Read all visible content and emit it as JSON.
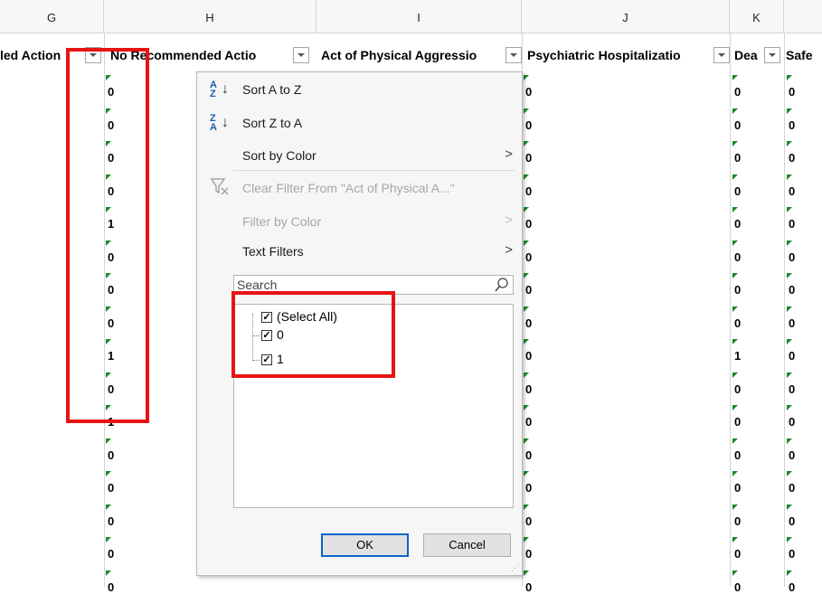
{
  "column_letters": [
    "G",
    "H",
    "I",
    "J",
    "K"
  ],
  "headers": {
    "g": "led Action",
    "h": "No Recommended Actio",
    "i": "Act of Physical Aggressio",
    "j": "Psychiatric Hospitalizatio",
    "k": "Dea",
    "l": "Safe"
  },
  "col_g_values": [
    "0",
    "0",
    "0",
    "0",
    "1",
    "0",
    "0",
    "0",
    "1",
    "0",
    "1",
    "0",
    "0",
    "0",
    "0",
    "0"
  ],
  "col_j_values": [
    "0",
    "0",
    "0",
    "0",
    "0",
    "0",
    "0",
    "0",
    "0",
    "0",
    "0",
    "0",
    "0",
    "0",
    "0",
    "0"
  ],
  "col_k_values": [
    "0",
    "0",
    "0",
    "0",
    "0",
    "0",
    "0",
    "0",
    "1",
    "0",
    "0",
    "0",
    "0",
    "0",
    "0",
    "0"
  ],
  "col_l_values": [
    "0",
    "0",
    "0",
    "0",
    "0",
    "0",
    "0",
    "0",
    "0",
    "0",
    "0",
    "0",
    "0",
    "0",
    "0",
    "0"
  ],
  "menu": {
    "sort_az": "Sort A to Z",
    "sort_za": "Sort Z to A",
    "sort_by_color": "Sort by Color",
    "clear_filter": "Clear Filter From \"Act of Physical A...\"",
    "filter_by_color": "Filter by Color",
    "text_filters": "Text Filters",
    "search_placeholder": "Search",
    "list": [
      {
        "label": "(Select All)",
        "checked": true
      },
      {
        "label": "0",
        "checked": true
      },
      {
        "label": "1",
        "checked": true
      }
    ],
    "ok": "OK",
    "cancel": "Cancel"
  },
  "colors": {
    "highlight": "#e81313",
    "accent": "#0a64c8",
    "comment_triangle": "#1a8a2b"
  }
}
